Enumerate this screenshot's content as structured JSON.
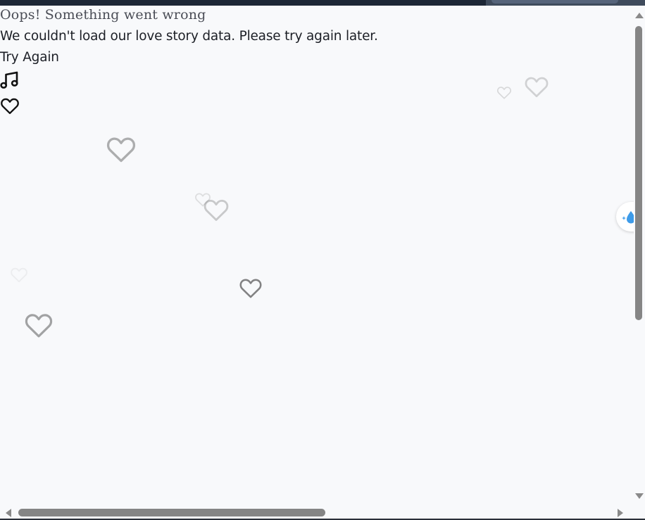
{
  "error": {
    "title": "Oops! Something went wrong",
    "message": "We couldn't load our love story data. Please try again later.",
    "retry_label": "Try Again"
  },
  "controls": {
    "music_icon": "music-note-icon",
    "like_icon": "heart-outline-icon"
  },
  "decorations": {
    "floating_icon": "heart-outline-icon"
  },
  "side_widget": {
    "icon": "water-drop-sparkle-icon",
    "accent_color": "#3d9be9"
  },
  "colors": {
    "background": "#f8f9fb",
    "text": "#1c1f26",
    "title_text": "#4a4d56",
    "topbar": "#1d2736",
    "scrollbar_thumb": "#858585"
  }
}
